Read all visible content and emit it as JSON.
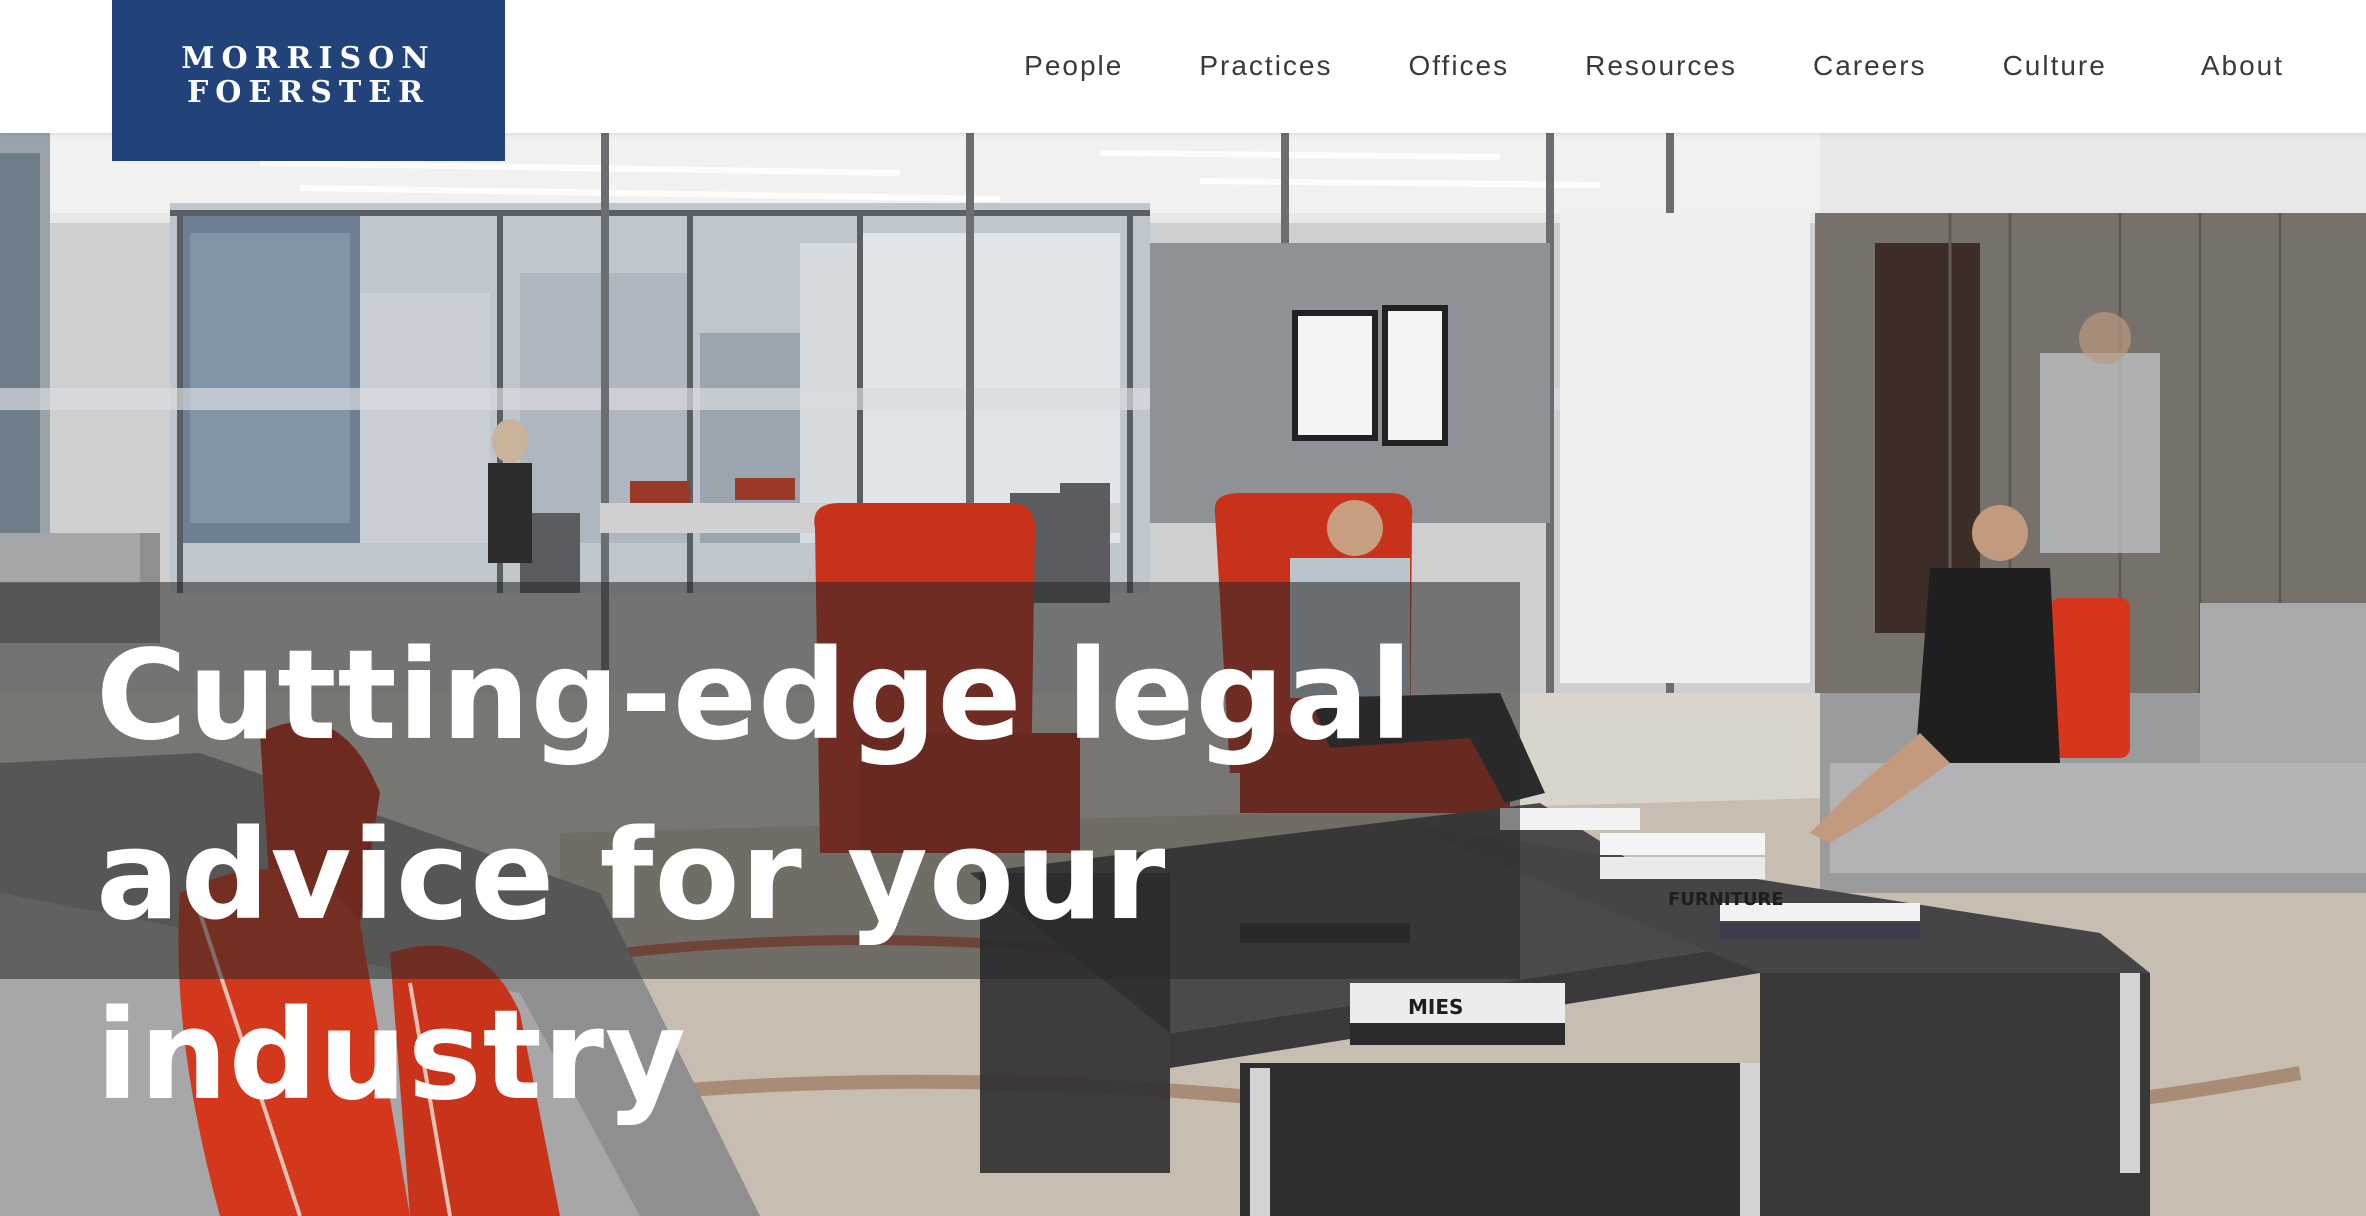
{
  "brand": {
    "logo_line1": "MORRISON",
    "logo_line2": "FOERSTER",
    "brand_color": "#22427a"
  },
  "nav": {
    "items": [
      {
        "label": "People"
      },
      {
        "label": "Practices"
      },
      {
        "label": "Offices"
      },
      {
        "label": "Resources"
      },
      {
        "label": "Careers"
      },
      {
        "label": "Culture"
      },
      {
        "label": "About"
      }
    ]
  },
  "hero": {
    "headline_line1": "Cutting-edge legal",
    "headline_line2": "advice for your industry",
    "image_description": "office lounge",
    "book_label_1": "FURNITURE",
    "book_label_2": "MIES",
    "accent_color": "#d8361c"
  }
}
